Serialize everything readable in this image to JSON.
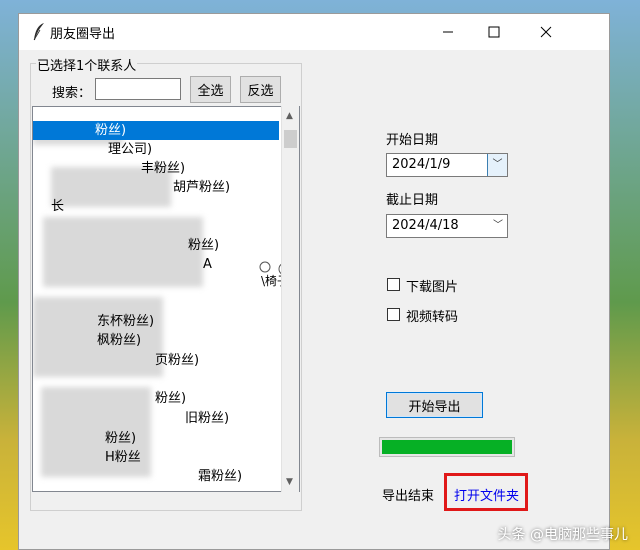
{
  "window": {
    "title": "朋友圈导出"
  },
  "contacts": {
    "group_label": "已选择1个联系人",
    "search_label": "搜索：",
    "search_value": "",
    "select_all_label": "全选",
    "invert_label": "反选",
    "items": [
      {
        "text": "粉丝)",
        "selected": true
      },
      {
        "text": "理公司)",
        "selected": false
      },
      {
        "text": "丰粉丝)",
        "selected": false
      },
      {
        "text": "胡芦粉丝)",
        "selected": false
      },
      {
        "text": "长",
        "selected": false
      },
      {
        "text": "粉丝)",
        "selected": false
      },
      {
        "text": "A",
        "selected": false
      },
      {
        "text": "\\椅子",
        "selected": false
      },
      {
        "text": "东杯粉丝)",
        "selected": false
      },
      {
        "text": "枫粉丝)",
        "selected": false
      },
      {
        "text": "页粉丝)",
        "selected": false
      },
      {
        "text": "粉丝)",
        "selected": false
      },
      {
        "text": "旧粉丝)",
        "selected": false
      },
      {
        "text": "粉丝)",
        "selected": false
      },
      {
        "text": "H粉丝",
        "selected": false
      },
      {
        "text": "霜粉丝)",
        "selected": false
      }
    ]
  },
  "dates": {
    "start_label": "开始日期",
    "start_value": "2024/1/9",
    "end_label": "截止日期",
    "end_value": "2024/4/18"
  },
  "options": {
    "download_images_label": "下载图片",
    "download_images_checked": false,
    "video_transcode_label": "视频转码",
    "video_transcode_checked": false
  },
  "export": {
    "button_label": "开始导出",
    "progress_percent": 100,
    "status_text": "导出结束",
    "open_folder_label": "打开文件夹"
  },
  "watermark": "头条 @电脑那些事儿",
  "colors": {
    "selection": "#0078d7",
    "progress": "#06b025",
    "highlight_box": "#e01818"
  }
}
